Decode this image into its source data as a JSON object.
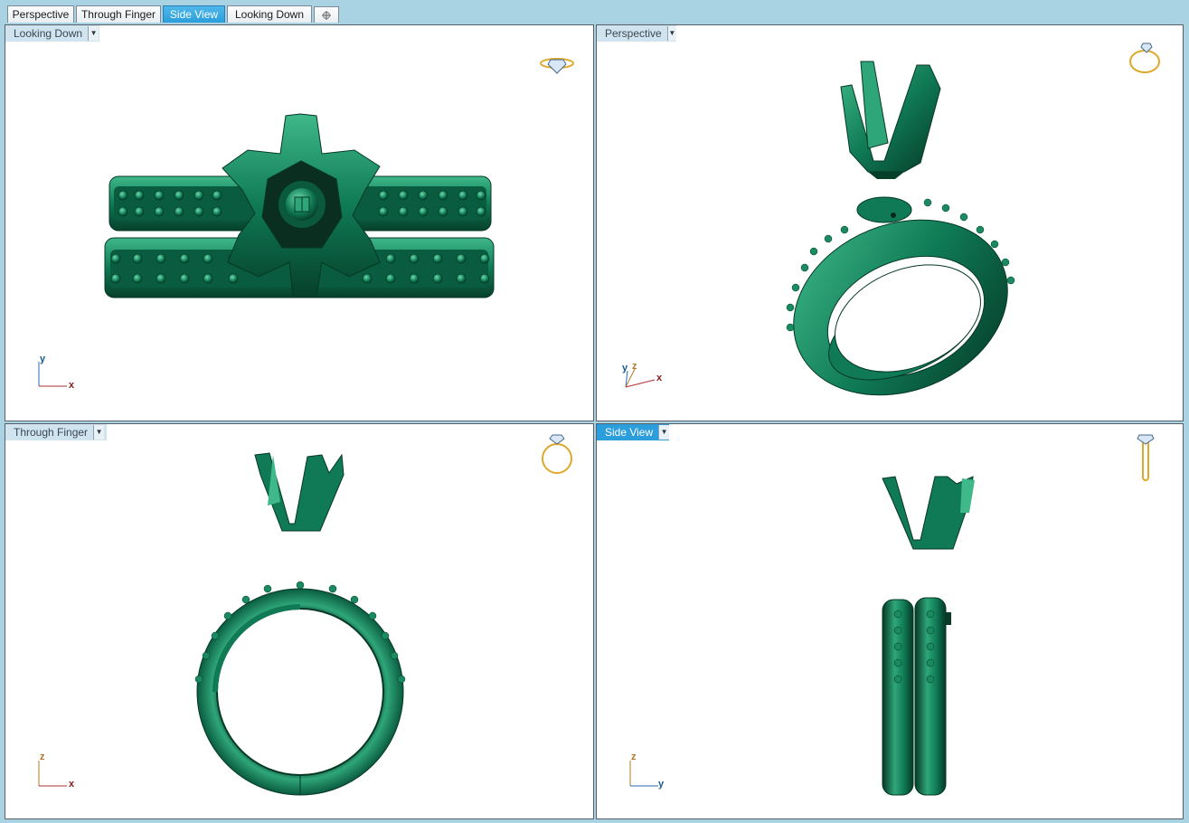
{
  "tabs": [
    {
      "label": "Perspective",
      "active": false
    },
    {
      "label": "Through Finger",
      "active": false
    },
    {
      "label": "Side View",
      "active": true
    },
    {
      "label": "Looking Down",
      "active": false
    }
  ],
  "add_tab_icon": "plus-icon",
  "viewports": {
    "top_left": {
      "label": "Looking Down",
      "axis_h": "x",
      "axis_v": "y"
    },
    "top_right": {
      "label": "Perspective",
      "axis_h": "x",
      "axis_v": "z",
      "axis_v2": "y"
    },
    "bottom_left": {
      "label": "Through Finger",
      "axis_h": "x",
      "axis_v": "z"
    },
    "bottom_right": {
      "label": "Side View",
      "axis_h": "y",
      "axis_v": "z"
    }
  },
  "colors": {
    "model_green": "#0f7a55",
    "model_dark": "#06402b",
    "model_light": "#3fb88a",
    "active_blue": "#2c9edc",
    "axis_x": "#8b1a1a",
    "axis_y": "#1a5a8b",
    "axis_z": "#b07a2a",
    "ring_icon_gold": "#e0a82a"
  }
}
